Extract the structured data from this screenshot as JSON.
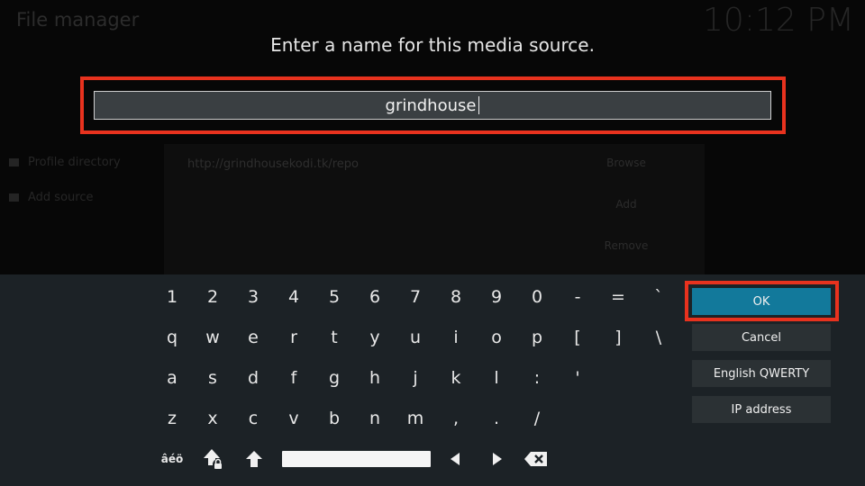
{
  "background": {
    "title": "File manager",
    "clock": "10:12 PM",
    "sidebar": [
      "Profile directory",
      "Add source"
    ],
    "source_url": "http://grindhousekodi.tk/repo",
    "buttons": [
      "Browse",
      "Add",
      "Remove"
    ]
  },
  "dialog": {
    "heading": "Enter a name for this media source.",
    "input_value": "grindhouse"
  },
  "keyboard": {
    "rows": [
      [
        "1",
        "2",
        "3",
        "4",
        "5",
        "6",
        "7",
        "8",
        "9",
        "0",
        "-",
        "=",
        "`"
      ],
      [
        "q",
        "w",
        "e",
        "r",
        "t",
        "y",
        "u",
        "i",
        "o",
        "p",
        "[",
        "]",
        "\\"
      ],
      [
        "a",
        "s",
        "d",
        "f",
        "g",
        "h",
        "j",
        "k",
        "l",
        ":",
        "'"
      ],
      [
        "z",
        "x",
        "c",
        "v",
        "b",
        "n",
        "m",
        ",",
        ".",
        "/"
      ]
    ],
    "symbols_label": "âéö"
  },
  "side_buttons": {
    "ok": "OK",
    "cancel": "Cancel",
    "layout": "English QWERTY",
    "ip": "IP address"
  },
  "colors": {
    "highlight": "#e8321e",
    "ok_button": "#12799b",
    "keyboard_bg": "#1c2226"
  }
}
